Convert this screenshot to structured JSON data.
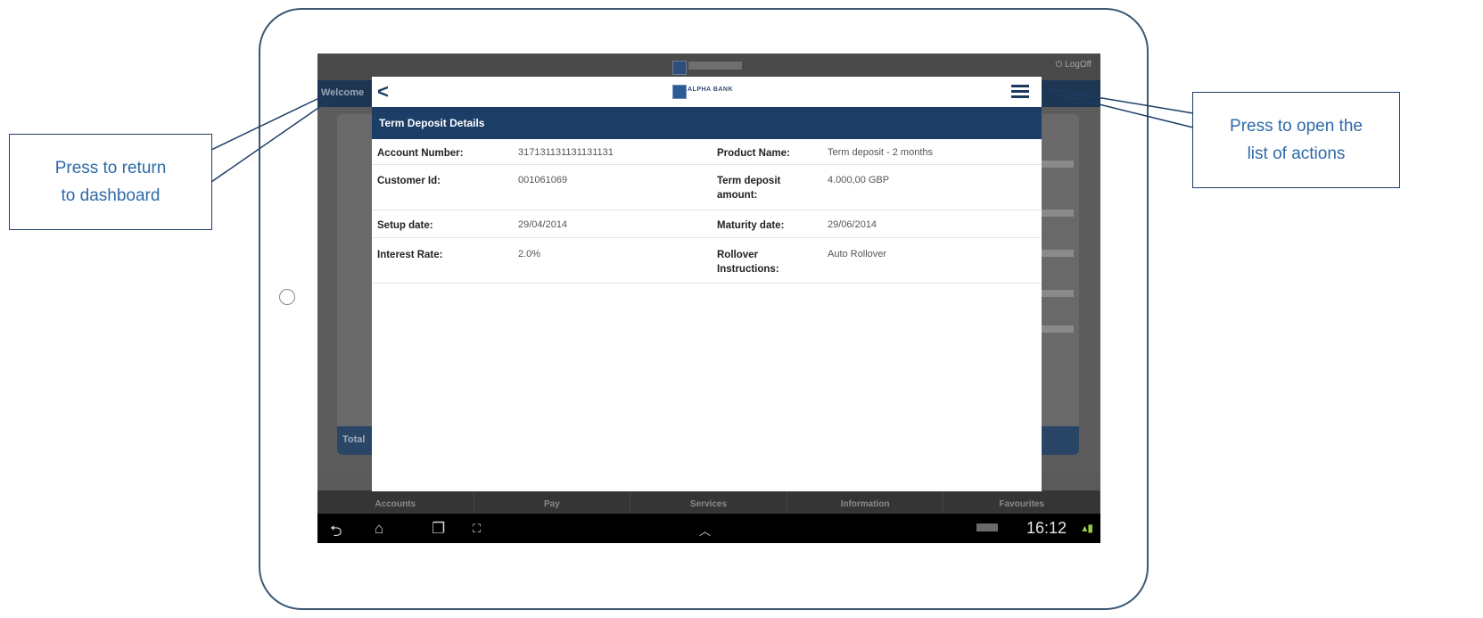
{
  "callouts": {
    "left": {
      "line1": "Press to return",
      "line2": "to dashboard"
    },
    "right": {
      "line1": "Press to open the",
      "line2": "list of actions"
    }
  },
  "background_app": {
    "welcome": "Welcome",
    "logoff": "LogOff",
    "total": "Total",
    "nav": [
      "Accounts",
      "Pay",
      "Services",
      "Information",
      "Favourites"
    ]
  },
  "system_bar": {
    "time": "16:12",
    "icons": [
      "back-nav-icon",
      "home-nav-icon",
      "recent-apps-icon",
      "screenshot-icon",
      "up-chevron-icon"
    ]
  },
  "modal": {
    "brand": "ALPHA BANK",
    "title": "Term Deposit Details",
    "rows": [
      {
        "l1": "Account Number:",
        "v1": "317131131131131131",
        "l2": "Product Name:",
        "v2": "Term deposit - 2 months"
      },
      {
        "l1": "Customer Id:",
        "v1": "001061069",
        "l2": "Term deposit amount:",
        "v2": "4.000,00 GBP"
      },
      {
        "l1": "Setup date:",
        "v1": "29/04/2014",
        "l2": "Maturity date:",
        "v2": "29/06/2014"
      },
      {
        "l1": "Interest Rate:",
        "v1": "2.0%",
        "l2": "Rollover Instructions:",
        "v2": "Auto Rollover"
      }
    ]
  },
  "colors": {
    "primary": "#1c3d66",
    "callout_text": "#2e6aa8"
  }
}
